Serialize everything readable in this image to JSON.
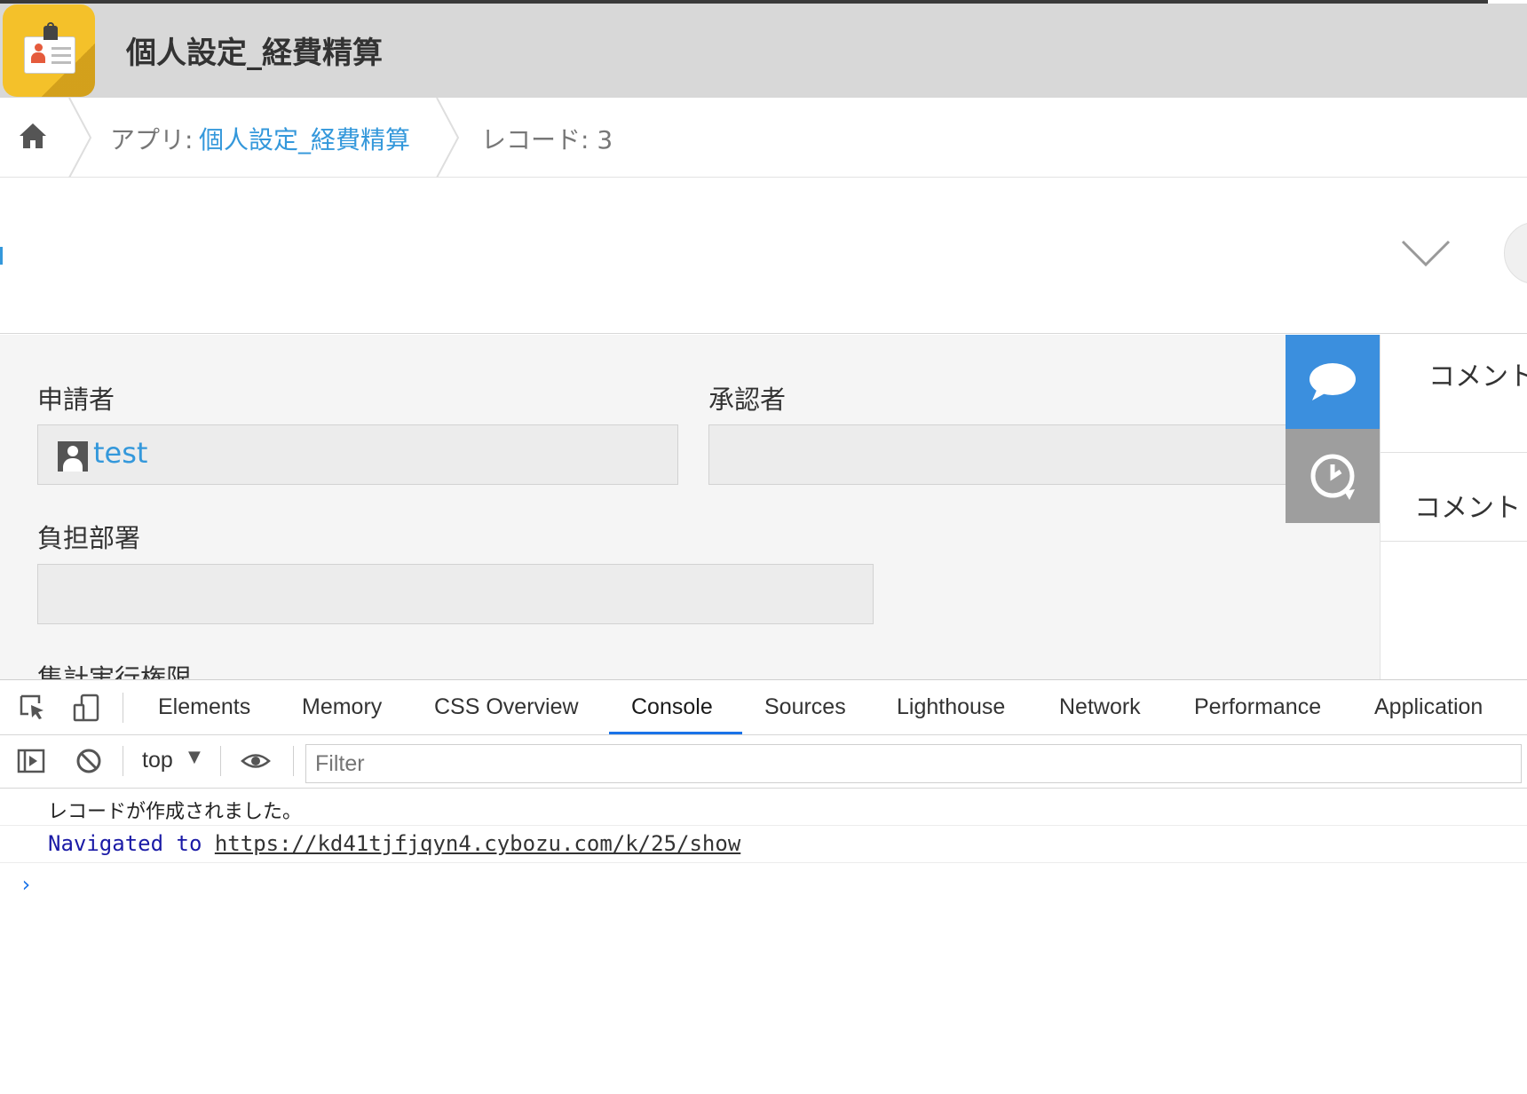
{
  "app": {
    "title": "個人設定_経費精算"
  },
  "breadcrumb": {
    "app_prefix": "アプリ:",
    "app_name": "個人設定_経費精算",
    "record": "レコード: 3"
  },
  "form": {
    "applicant_label": "申請者",
    "applicant_value": "test",
    "approver_label": "承認者",
    "department_label": "負担部署",
    "permission_label": "集計実行権限"
  },
  "side_panel": {
    "title": "コメント",
    "input_hint": "コメント"
  },
  "devtools": {
    "tabs": [
      "Elements",
      "Memory",
      "CSS Overview",
      "Console",
      "Sources",
      "Lighthouse",
      "Network",
      "Performance",
      "Application"
    ],
    "active_tab": "Console",
    "context": "top",
    "filter_placeholder": "Filter",
    "console": {
      "message": "レコードが作成されました。",
      "nav_prefix": "Navigated to ",
      "nav_url": "https://kd41tjfjqyn4.cybozu.com/k/25/show",
      "prompt": "›"
    }
  },
  "colors": {
    "accent": "#3498db",
    "comment_tab": "#3b8fde",
    "history_tab": "#9e9e9e",
    "devtools_active": "#1a73e8"
  }
}
